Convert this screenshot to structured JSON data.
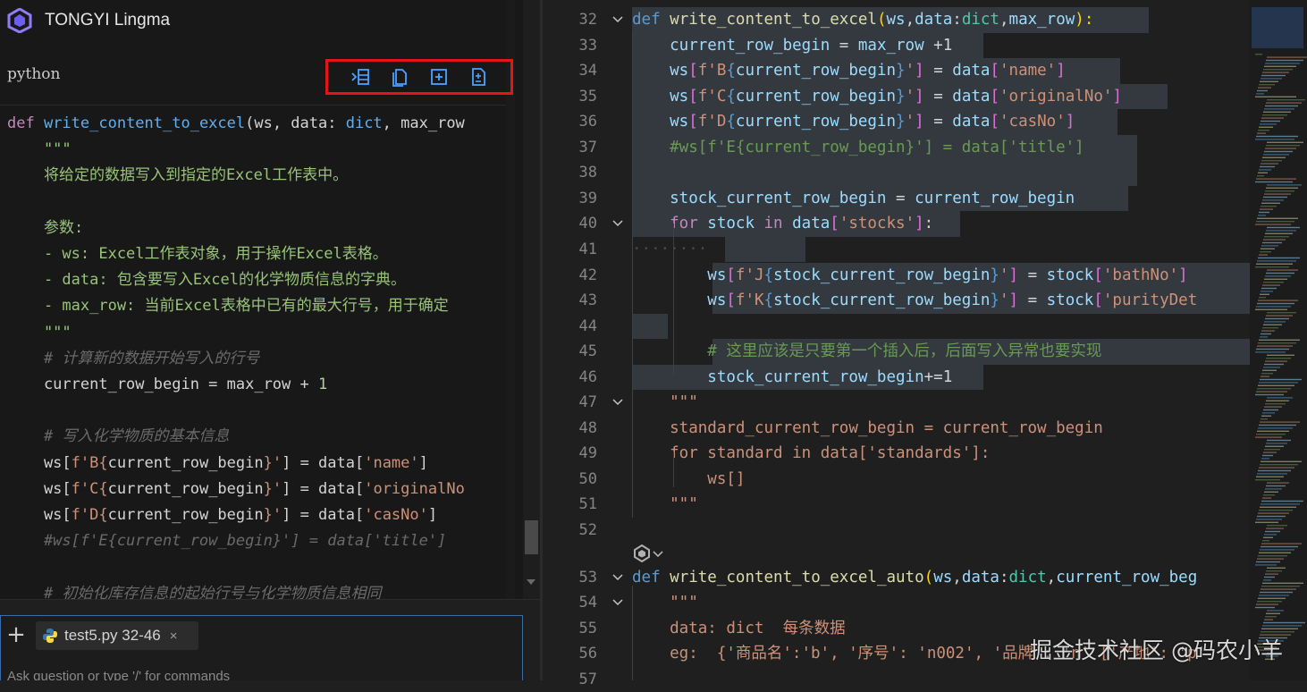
{
  "app": {
    "title": "TONGYI Lingma"
  },
  "code_block": {
    "language": "python",
    "toolbar": {
      "insert_label": "insert-at-cursor",
      "copy_label": "copy",
      "new_file_label": "new-file",
      "apply_diff_label": "apply"
    },
    "lines": [
      [
        [
          "def ",
          "kw"
        ],
        [
          "write_content_to_excel",
          "fn"
        ],
        [
          "(ws, data: ",
          "plain"
        ],
        [
          "dict",
          "fn"
        ],
        [
          ", max_row",
          "plain"
        ]
      ],
      [
        [
          "    \"\"\"",
          "doc"
        ]
      ],
      [
        [
          "    将给定的数据写入到指定的Excel工作表中。",
          "doc"
        ]
      ],
      [
        [
          "",
          "plain"
        ]
      ],
      [
        [
          "    参数:",
          "doc"
        ]
      ],
      [
        [
          "    - ws: Excel工作表对象，用于操作Excel表格。",
          "doc"
        ]
      ],
      [
        [
          "    - data: 包含要写入Excel的化学物质信息的字典。",
          "doc"
        ]
      ],
      [
        [
          "    - max_row: 当前Excel表格中已有的最大行号，用于确定",
          "doc"
        ]
      ],
      [
        [
          "    \"\"\"",
          "doc"
        ]
      ],
      [
        [
          "    # 计算新的数据开始写入的行号",
          "cm"
        ]
      ],
      [
        [
          "    current_row_begin = max_row + ",
          "plain"
        ],
        [
          "1",
          "num"
        ]
      ],
      [
        [
          "",
          "plain"
        ]
      ],
      [
        [
          "    # 写入化学物质的基本信息",
          "cm"
        ]
      ],
      [
        [
          "    ws[",
          "plain"
        ],
        [
          "f'B{",
          "str"
        ],
        [
          "current_row_begin",
          "plain"
        ],
        [
          "}'",
          "str"
        ],
        [
          "] = data[",
          "plain"
        ],
        [
          "'name'",
          "str"
        ],
        [
          "]",
          "plain"
        ]
      ],
      [
        [
          "    ws[",
          "plain"
        ],
        [
          "f'C{",
          "str"
        ],
        [
          "current_row_begin",
          "plain"
        ],
        [
          "}'",
          "str"
        ],
        [
          "] = data[",
          "plain"
        ],
        [
          "'originalNo",
          "str"
        ]
      ],
      [
        [
          "    ws[",
          "plain"
        ],
        [
          "f'D{",
          "str"
        ],
        [
          "current_row_begin",
          "plain"
        ],
        [
          "}'",
          "str"
        ],
        [
          "] = data[",
          "plain"
        ],
        [
          "'casNo'",
          "str"
        ],
        [
          "]",
          "plain"
        ]
      ],
      [
        [
          "    #ws[f'E{current_row_begin}'] = data['title']",
          "cm"
        ]
      ],
      [
        [
          "",
          "plain"
        ]
      ],
      [
        [
          "    # 初始化库存信息的起始行号与化学物质信息相同",
          "cm"
        ]
      ]
    ]
  },
  "chat": {
    "add_button": "+",
    "file_chip": {
      "name": "test5.py 32-46",
      "close": "×"
    },
    "placeholder": "Ask question or type '/' for commands"
  },
  "editor": {
    "lines": [
      {
        "no": "32",
        "fold": true,
        "segs": [
          [
            "def ",
            "kw-e"
          ],
          [
            "write_content_to_excel",
            "fn-e"
          ],
          [
            "(",
            "gold"
          ],
          [
            "ws",
            "var-e"
          ],
          [
            ",",
            "plain"
          ],
          [
            "data",
            "var-e"
          ],
          [
            ":",
            "plain"
          ],
          [
            "dict",
            "cls-e"
          ],
          [
            ",",
            "plain"
          ],
          [
            "max_row",
            "var-e"
          ],
          [
            "):",
            "gold"
          ]
        ]
      },
      {
        "no": "33",
        "segs": [
          [
            "    current_row_begin ",
            "var-e"
          ],
          [
            "= ",
            "plain"
          ],
          [
            "max_row ",
            "var-e"
          ],
          [
            "+1",
            "plain"
          ]
        ]
      },
      {
        "no": "34",
        "segs": [
          [
            "    ws",
            "var-e"
          ],
          [
            "[",
            "purp"
          ],
          [
            "f'B",
            "fstr"
          ],
          [
            "{",
            "brace"
          ],
          [
            "current_row_begin",
            "var-e"
          ],
          [
            "}",
            "brace"
          ],
          [
            "'",
            "fstr"
          ],
          [
            "] ",
            "purp"
          ],
          [
            "= ",
            "plain"
          ],
          [
            "data",
            "var-e"
          ],
          [
            "[",
            "purp"
          ],
          [
            "'name'",
            "fstr"
          ],
          [
            "]",
            "purp"
          ]
        ]
      },
      {
        "no": "35",
        "segs": [
          [
            "    ws",
            "var-e"
          ],
          [
            "[",
            "purp"
          ],
          [
            "f'C",
            "fstr"
          ],
          [
            "{",
            "brace"
          ],
          [
            "current_row_begin",
            "var-e"
          ],
          [
            "}",
            "brace"
          ],
          [
            "'",
            "fstr"
          ],
          [
            "] ",
            "purp"
          ],
          [
            "= ",
            "plain"
          ],
          [
            "data",
            "var-e"
          ],
          [
            "[",
            "purp"
          ],
          [
            "'originalNo'",
            "fstr"
          ],
          [
            "]",
            "purp"
          ]
        ]
      },
      {
        "no": "36",
        "segs": [
          [
            "    ws",
            "var-e"
          ],
          [
            "[",
            "purp"
          ],
          [
            "f'D",
            "fstr"
          ],
          [
            "{",
            "brace"
          ],
          [
            "current_row_begin",
            "var-e"
          ],
          [
            "}",
            "brace"
          ],
          [
            "'",
            "fstr"
          ],
          [
            "] ",
            "purp"
          ],
          [
            "= ",
            "plain"
          ],
          [
            "data",
            "var-e"
          ],
          [
            "[",
            "purp"
          ],
          [
            "'casNo'",
            "fstr"
          ],
          [
            "]",
            "purp"
          ]
        ]
      },
      {
        "no": "37",
        "segs": [
          [
            "    #ws[f'E{current_row_begin}'] = data['title']",
            "cm-e"
          ]
        ]
      },
      {
        "no": "38",
        "segs": [
          [
            "",
            "plain"
          ]
        ]
      },
      {
        "no": "39",
        "segs": [
          [
            "    stock_current_row_begin ",
            "var-e"
          ],
          [
            "= ",
            "plain"
          ],
          [
            "current_row_begin",
            "var-e"
          ]
        ]
      },
      {
        "no": "40",
        "fold": true,
        "segs": [
          [
            "    for ",
            "kw-f"
          ],
          [
            "stock ",
            "var-e"
          ],
          [
            "in ",
            "kw-f"
          ],
          [
            "data",
            "var-e"
          ],
          [
            "[",
            "purp"
          ],
          [
            "'stocks'",
            "fstr"
          ],
          [
            "]",
            "purp"
          ],
          [
            ":",
            "plain"
          ]
        ]
      },
      {
        "no": "41",
        "segs": [
          [
            "········",
            "dots"
          ]
        ]
      },
      {
        "no": "42",
        "segs": [
          [
            "        ws",
            "var-e"
          ],
          [
            "[",
            "purp"
          ],
          [
            "f'J",
            "fstr"
          ],
          [
            "{",
            "brace"
          ],
          [
            "stock_current_row_begin",
            "var-e"
          ],
          [
            "}",
            "brace"
          ],
          [
            "'",
            "fstr"
          ],
          [
            "] ",
            "purp"
          ],
          [
            "= ",
            "plain"
          ],
          [
            "stock",
            "var-e"
          ],
          [
            "[",
            "purp"
          ],
          [
            "'bathNo'",
            "fstr"
          ],
          [
            "]",
            "purp"
          ]
        ]
      },
      {
        "no": "43",
        "segs": [
          [
            "        ws",
            "var-e"
          ],
          [
            "[",
            "purp"
          ],
          [
            "f'K",
            "fstr"
          ],
          [
            "{",
            "brace"
          ],
          [
            "stock_current_row_begin",
            "var-e"
          ],
          [
            "}",
            "brace"
          ],
          [
            "'",
            "fstr"
          ],
          [
            "] ",
            "purp"
          ],
          [
            "= ",
            "plain"
          ],
          [
            "stock",
            "var-e"
          ],
          [
            "[",
            "purp"
          ],
          [
            "'purityDet",
            "fstr"
          ]
        ]
      },
      {
        "no": "44",
        "segs": [
          [
            "",
            "plain"
          ]
        ]
      },
      {
        "no": "45",
        "segs": [
          [
            "        # 这里应该是只要第一个插入后，后面写入异常也要实现",
            "cm-e"
          ]
        ]
      },
      {
        "no": "46",
        "segs": [
          [
            "        stock_current_row_begin",
            "var-e"
          ],
          [
            "+=1",
            "plain"
          ]
        ]
      },
      {
        "no": "47",
        "fold": true,
        "segs": [
          [
            "    \"\"\"",
            "fstr"
          ]
        ]
      },
      {
        "no": "48",
        "segs": [
          [
            "    standard_current_row_begin = current_row_begin",
            "fstr"
          ]
        ]
      },
      {
        "no": "49",
        "segs": [
          [
            "    for standard in data['standards']:",
            "fstr"
          ]
        ]
      },
      {
        "no": "50",
        "segs": [
          [
            "        ws[]",
            "fstr"
          ]
        ]
      },
      {
        "no": "51",
        "segs": [
          [
            "    \"\"\"",
            "fstr"
          ]
        ]
      },
      {
        "no": "52",
        "segs": [
          [
            "",
            "plain"
          ]
        ]
      },
      {
        "no": "53",
        "fold": true,
        "segs": [
          [
            "def ",
            "kw-e"
          ],
          [
            "write_content_to_excel_auto",
            "fn-e"
          ],
          [
            "(",
            "gold"
          ],
          [
            "ws",
            "var-e"
          ],
          [
            ",",
            "plain"
          ],
          [
            "data",
            "var-e"
          ],
          [
            ":",
            "plain"
          ],
          [
            "dict",
            "cls-e"
          ],
          [
            ",",
            "plain"
          ],
          [
            "current_row_beg",
            "var-e"
          ]
        ]
      },
      {
        "no": "54",
        "fold": true,
        "segs": [
          [
            "    \"\"\"",
            "fstr"
          ]
        ]
      },
      {
        "no": "55",
        "segs": [
          [
            "    data: dict  每条数据",
            "fstr"
          ]
        ]
      },
      {
        "no": "56",
        "segs": [
          [
            "    eg:  {'商品名':'b', '序号': 'n002', '品牌': 'n' ['产地': 'p'",
            "fstr"
          ]
        ]
      },
      {
        "no": "57",
        "segs": [
          [
            "",
            "plain"
          ]
        ]
      }
    ]
  },
  "watermark": "掘金技术社区 @码农小羊",
  "colors": {
    "accent_red": "#e3141b",
    "toolbar_icon": "#4da3ff",
    "selection": "#33393f"
  }
}
